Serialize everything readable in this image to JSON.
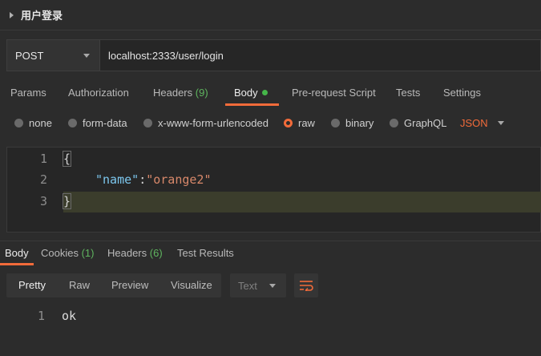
{
  "request": {
    "title": "用户登录",
    "method": "POST",
    "url": "localhost:2333/user/login"
  },
  "request_tabs": {
    "params": "Params",
    "authorization": "Authorization",
    "headers": "Headers",
    "headers_count": "(9)",
    "body": "Body",
    "prerequest": "Pre-request Script",
    "tests": "Tests",
    "settings": "Settings"
  },
  "body_types": {
    "none": "none",
    "form_data": "form-data",
    "urlencoded": "x-www-form-urlencoded",
    "raw": "raw",
    "binary": "binary",
    "graphql": "GraphQL",
    "format": "JSON"
  },
  "editor": {
    "line_numbers": [
      "1",
      "2",
      "3"
    ],
    "open_brace": "{",
    "key": "\"name\"",
    "colon": ":",
    "value": "\"orange2\"",
    "close_brace": "}"
  },
  "response_tabs": {
    "body": "Body",
    "cookies": "Cookies",
    "cookies_count": "(1)",
    "headers": "Headers",
    "headers_count": "(6)",
    "test_results": "Test Results"
  },
  "view": {
    "pretty": "Pretty",
    "raw": "Raw",
    "preview": "Preview",
    "visualize": "Visualize",
    "format": "Text"
  },
  "response": {
    "line_number": "1",
    "text": "ok"
  },
  "colors": {
    "accent": "#f26b3a",
    "count_green": "#5fb45f",
    "json_key": "#7cc7ee",
    "json_string": "#d8886a"
  }
}
